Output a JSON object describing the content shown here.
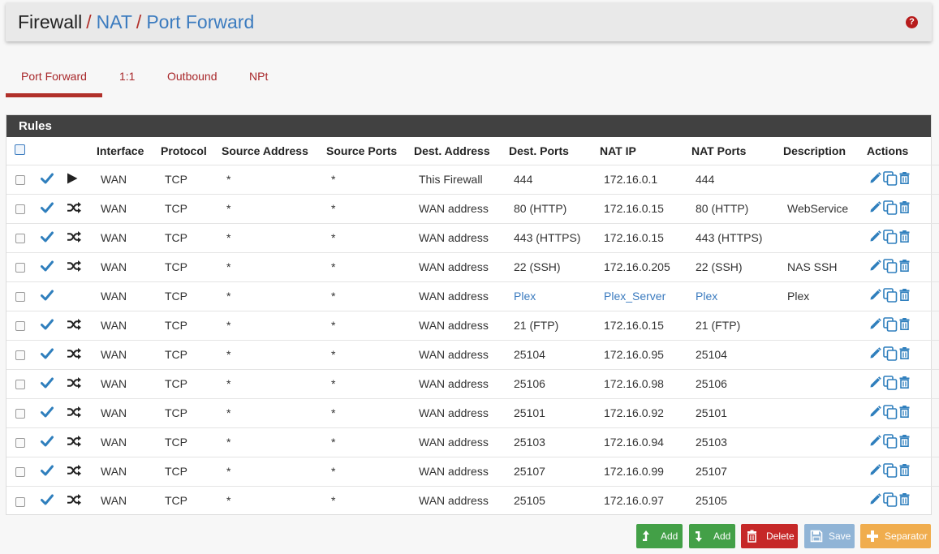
{
  "breadcrumb": {
    "first": "Firewall",
    "second": "NAT",
    "third": "Port Forward",
    "separator": "/"
  },
  "help_icon": "question-circle-icon",
  "tabs": [
    {
      "label": "Port Forward",
      "active": true
    },
    {
      "label": "1:1",
      "active": false
    },
    {
      "label": "Outbound",
      "active": false
    },
    {
      "label": "NPt",
      "active": false
    }
  ],
  "panel": {
    "title": "Rules"
  },
  "columns": [
    "Interface",
    "Protocol",
    "Source Address",
    "Source Ports",
    "Dest. Address",
    "Dest. Ports",
    "NAT IP",
    "NAT Ports",
    "Description",
    "Actions"
  ],
  "rules": [
    {
      "icon": "play-icon",
      "interface": "WAN",
      "protocol": "TCP",
      "src_addr": "*",
      "src_ports": "*",
      "dest_addr": "This Firewall",
      "dest_ports": "444",
      "nat_ip": "172.16.0.1",
      "nat_ports": "444",
      "description": ""
    },
    {
      "icon": "shuffle-icon",
      "interface": "WAN",
      "protocol": "TCP",
      "src_addr": "*",
      "src_ports": "*",
      "dest_addr": "WAN address",
      "dest_ports": "80 (HTTP)",
      "nat_ip": "172.16.0.15",
      "nat_ports": "80 (HTTP)",
      "description": "WebService"
    },
    {
      "icon": "shuffle-icon",
      "interface": "WAN",
      "protocol": "TCP",
      "src_addr": "*",
      "src_ports": "*",
      "dest_addr": "WAN address",
      "dest_ports": "443 (HTTPS)",
      "nat_ip": "172.16.0.15",
      "nat_ports": "443 (HTTPS)",
      "description": ""
    },
    {
      "icon": "shuffle-icon",
      "interface": "WAN",
      "protocol": "TCP",
      "src_addr": "*",
      "src_ports": "*",
      "dest_addr": "WAN address",
      "dest_ports": "22 (SSH)",
      "nat_ip": "172.16.0.205",
      "nat_ports": "22 (SSH)",
      "description": "NAS SSH"
    },
    {
      "icon": "",
      "interface": "WAN",
      "protocol": "TCP",
      "src_addr": "*",
      "src_ports": "*",
      "dest_addr": "WAN address",
      "dest_ports": "Plex",
      "nat_ip": "Plex_Server",
      "nat_ports": "Plex",
      "description": "Plex",
      "alias_links": true
    },
    {
      "icon": "shuffle-icon",
      "interface": "WAN",
      "protocol": "TCP",
      "src_addr": "*",
      "src_ports": "*",
      "dest_addr": "WAN address",
      "dest_ports": "21 (FTP)",
      "nat_ip": "172.16.0.15",
      "nat_ports": "21 (FTP)",
      "description": ""
    },
    {
      "icon": "shuffle-icon",
      "interface": "WAN",
      "protocol": "TCP",
      "src_addr": "*",
      "src_ports": "*",
      "dest_addr": "WAN address",
      "dest_ports": "25104",
      "nat_ip": "172.16.0.95",
      "nat_ports": "25104",
      "description": ""
    },
    {
      "icon": "shuffle-icon",
      "interface": "WAN",
      "protocol": "TCP",
      "src_addr": "*",
      "src_ports": "*",
      "dest_addr": "WAN address",
      "dest_ports": "25106",
      "nat_ip": "172.16.0.98",
      "nat_ports": "25106",
      "description": ""
    },
    {
      "icon": "shuffle-icon",
      "interface": "WAN",
      "protocol": "TCP",
      "src_addr": "*",
      "src_ports": "*",
      "dest_addr": "WAN address",
      "dest_ports": "25101",
      "nat_ip": "172.16.0.92",
      "nat_ports": "25101",
      "description": ""
    },
    {
      "icon": "shuffle-icon",
      "interface": "WAN",
      "protocol": "TCP",
      "src_addr": "*",
      "src_ports": "*",
      "dest_addr": "WAN address",
      "dest_ports": "25103",
      "nat_ip": "172.16.0.94",
      "nat_ports": "25103",
      "description": ""
    },
    {
      "icon": "shuffle-icon",
      "interface": "WAN",
      "protocol": "TCP",
      "src_addr": "*",
      "src_ports": "*",
      "dest_addr": "WAN address",
      "dest_ports": "25107",
      "nat_ip": "172.16.0.99",
      "nat_ports": "25107",
      "description": ""
    },
    {
      "icon": "shuffle-icon",
      "interface": "WAN",
      "protocol": "TCP",
      "src_addr": "*",
      "src_ports": "*",
      "dest_addr": "WAN address",
      "dest_ports": "25105",
      "nat_ip": "172.16.0.97",
      "nat_ports": "25105",
      "description": ""
    }
  ],
  "buttons": {
    "add_top": {
      "label": "Add",
      "icon": "arrow-up-icon",
      "color": "#43a047"
    },
    "add_bottom": {
      "label": "Add",
      "icon": "arrow-down-icon",
      "color": "#43a047"
    },
    "delete": {
      "label": "Delete",
      "icon": "trash-icon",
      "color": "#c62828"
    },
    "save": {
      "label": "Save",
      "icon": "save-icon",
      "color": "#90b4d6"
    },
    "separator": {
      "label": "Separator",
      "icon": "plus-icon",
      "color": "#f0ad4e"
    }
  },
  "colors": {
    "accent": "#b1302a",
    "link": "#3b7bbf",
    "panel_header": "#414141"
  }
}
